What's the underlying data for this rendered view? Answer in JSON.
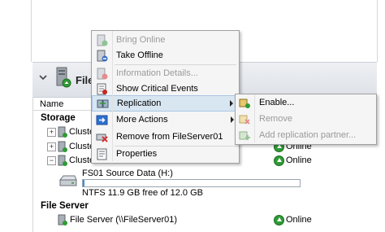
{
  "header": {
    "title": "FileSe"
  },
  "columns": {
    "name": "Name"
  },
  "storage": {
    "label": "Storage",
    "rows": [
      {
        "toggle": "+",
        "name": "Cluster",
        "status": ""
      },
      {
        "toggle": "+",
        "name": "Cluster",
        "status": "Online"
      },
      {
        "toggle": "−",
        "name": "Cluster",
        "status": "Online"
      }
    ],
    "disk": {
      "name": "FS01 Source Data (H:)",
      "detail": "NTFS 11.9 GB free of 12.0 GB",
      "used_fraction": 0.008
    }
  },
  "file_server": {
    "label": "File Server",
    "row": {
      "name": "File Server (\\\\FileServer01)",
      "status": "Online"
    }
  },
  "context_menu": {
    "items": [
      {
        "label": "Bring Online",
        "disabled": true,
        "icon": "bring-online-icon"
      },
      {
        "label": "Take Offline",
        "disabled": false,
        "icon": "take-offline-icon"
      },
      {
        "label": "Information Details...",
        "disabled": true,
        "icon": "information-details-icon"
      },
      {
        "label": "Show Critical Events",
        "disabled": false,
        "icon": "critical-events-icon"
      },
      {
        "label": "Replication",
        "disabled": false,
        "icon": "replication-icon",
        "submenu": true,
        "highlighted": true
      },
      {
        "label": "More Actions",
        "disabled": false,
        "icon": "more-actions-icon",
        "submenu": true
      },
      {
        "label": "Remove from FileServer01",
        "disabled": false,
        "icon": "remove-icon"
      },
      {
        "label": "Properties",
        "disabled": false,
        "icon": "properties-icon"
      }
    ]
  },
  "replication_submenu": {
    "items": [
      {
        "label": "Enable...",
        "disabled": false
      },
      {
        "label": "Remove",
        "disabled": true
      },
      {
        "label": "Add replication partner...",
        "disabled": true
      }
    ]
  },
  "colors": {
    "online_green": "#2f9a35",
    "highlight": "#d8e6f2",
    "disabled_text": "#9a9a9a"
  }
}
